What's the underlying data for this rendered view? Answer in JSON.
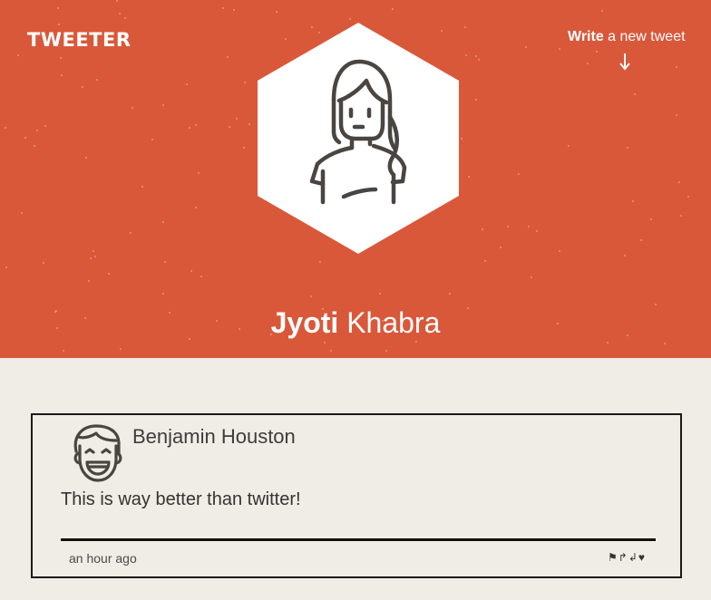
{
  "header": {
    "logo": "TWEETER",
    "compose_bold": "Write",
    "compose_rest": " a new tweet",
    "background_color": "#d9583a",
    "profile_icon": "hexagon-avatar-icon"
  },
  "profile": {
    "first_name": "Jyoti",
    "last_name": " Khabra"
  },
  "tweets": [
    {
      "author": "Benjamin Houston",
      "avatar_icon": "smiling-man-avatar-icon",
      "text": "This is way better than twitter!",
      "time": "an hour ago",
      "actions": [
        {
          "name": "flag-icon",
          "glyph": "⚑"
        },
        {
          "name": "retweet-icon",
          "glyph": "↱"
        },
        {
          "name": "reply-icon",
          "glyph": "↲"
        },
        {
          "name": "like-icon",
          "glyph": "♥"
        }
      ]
    }
  ]
}
